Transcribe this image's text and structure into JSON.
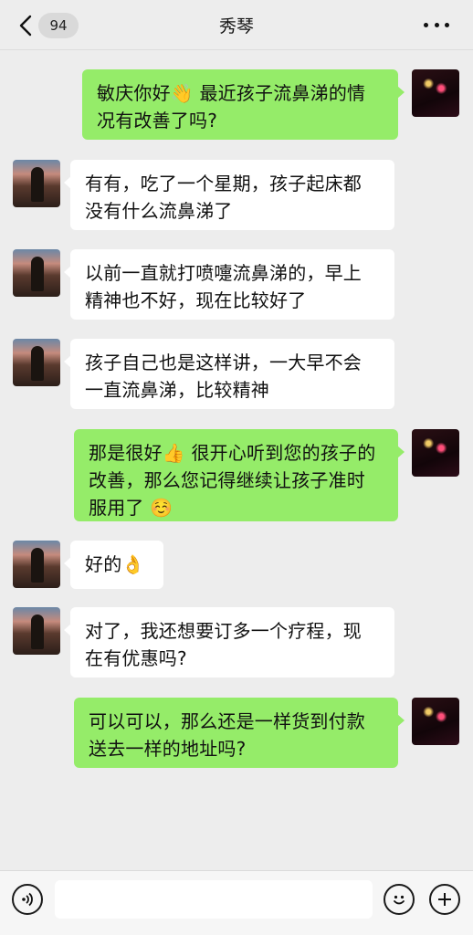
{
  "header": {
    "back_count": "94",
    "title": "秀琴"
  },
  "messages": [
    {
      "side": "out",
      "text": "敏庆你好👋 最近孩子流鼻涕的情况有改善了吗?"
    },
    {
      "side": "in",
      "text": "有有，吃了一个星期，孩子起床都没有什么流鼻涕了"
    },
    {
      "side": "in",
      "text": "以前一直就打喷嚏流鼻涕的，早上精神也不好，现在比较好了"
    },
    {
      "side": "in",
      "text": "孩子自己也是这样讲，一大早不会一直流鼻涕，比较精神"
    },
    {
      "side": "out",
      "text": "那是很好👍 很开心听到您的孩子的改善，那么您记得继续让孩子准时服用了 ☺️"
    },
    {
      "side": "in",
      "text": "好的👌"
    },
    {
      "side": "in",
      "text": "对了，我还想要订多一个疗程，现在有优惠吗?"
    },
    {
      "side": "out",
      "text": "可以可以，那么还是一样货到付款送去一样的地址吗?"
    }
  ],
  "input_bar": {
    "placeholder": "",
    "icons": [
      "voice-icon",
      "emoji-face-icon",
      "plus-icon"
    ]
  },
  "colors": {
    "background": "#ededed",
    "outgoing_bubble": "#95ec69",
    "incoming_bubble": "#ffffff"
  }
}
